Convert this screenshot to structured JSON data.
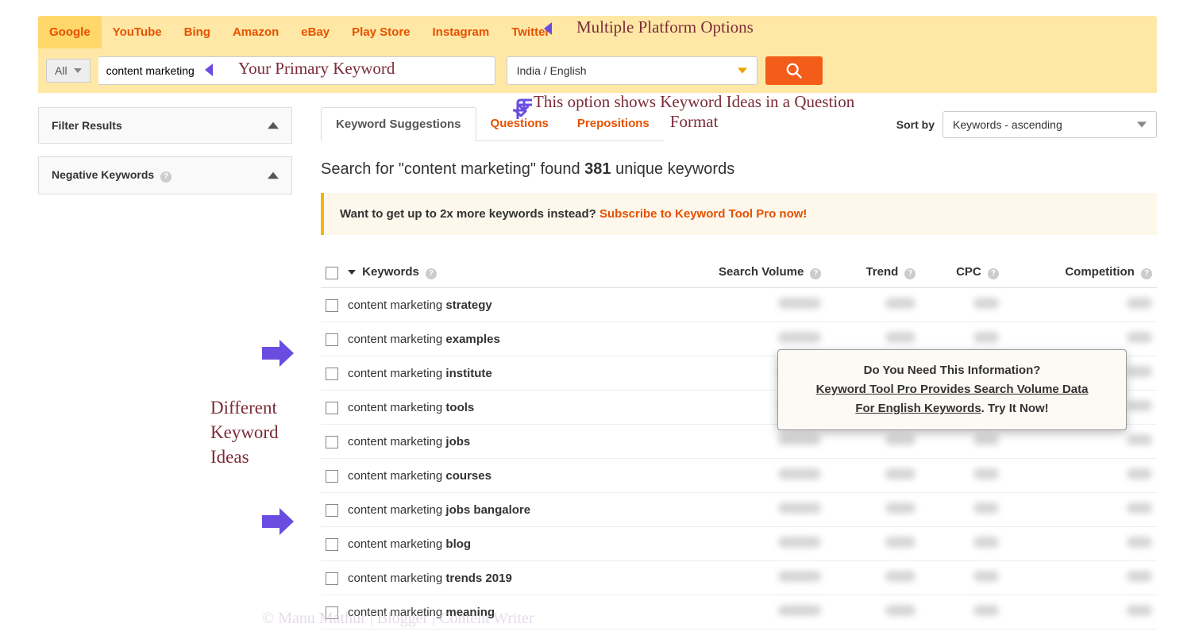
{
  "platform_tabs": [
    "Google",
    "YouTube",
    "Bing",
    "Amazon",
    "eBay",
    "Play Store",
    "Instagram",
    "Twitter"
  ],
  "active_platform": 0,
  "all_select": "All",
  "keyword_value": "content marketing",
  "location_value": "India / English",
  "sidebar": {
    "filter": "Filter Results",
    "negative": "Negative Keywords"
  },
  "result_tabs": [
    "Keyword Suggestions",
    "Questions",
    "Prepositions"
  ],
  "active_result_tab": 0,
  "sort_label": "Sort by",
  "sort_value": "Keywords - ascending",
  "found": {
    "prefix": "Search for \"content marketing\" found ",
    "count": "381",
    "suffix": " unique keywords"
  },
  "promo": {
    "text": "Want to get up to 2x more keywords instead? ",
    "link": "Subscribe to Keyword Tool Pro now!"
  },
  "columns": {
    "keywords": "Keywords",
    "sv": "Search Volume",
    "trend": "Trend",
    "cpc": "CPC",
    "comp": "Competition"
  },
  "rows": [
    {
      "base": "content marketing ",
      "suffix": "strategy"
    },
    {
      "base": "content marketing ",
      "suffix": "examples"
    },
    {
      "base": "content marketing ",
      "suffix": "institute"
    },
    {
      "base": "content marketing ",
      "suffix": "tools"
    },
    {
      "base": "content marketing ",
      "suffix": "jobs"
    },
    {
      "base": "content marketing ",
      "suffix": "courses"
    },
    {
      "base": "content marketing ",
      "suffix": "jobs bangalore"
    },
    {
      "base": "content marketing ",
      "suffix": "blog"
    },
    {
      "base": "content marketing ",
      "suffix": "trends 2019"
    },
    {
      "base": "content marketing ",
      "suffix": "meaning"
    }
  ],
  "tooltip": {
    "l1": "Do You Need This Information?",
    "l2": "Keyword Tool Pro Provides Search Volume Data",
    "l3_a": "For English Keywords",
    "l3_b": ". Try It Now!"
  },
  "annotations": {
    "platforms": "Multiple Platform Options",
    "primary": "Your Primary Keyword",
    "questions": "This option shows Keyword Ideas in a Question Format",
    "ideas_l1": "Different",
    "ideas_l2": "Keyword",
    "ideas_l3": "Ideas"
  },
  "watermark": "© Manu Mathur | Blogger | Content Writer"
}
